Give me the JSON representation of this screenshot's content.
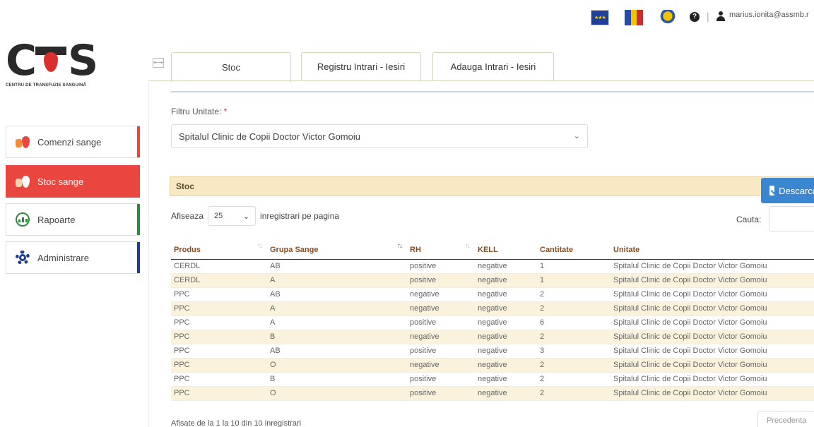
{
  "header": {
    "user_email": "marius.ionita@assmb.r",
    "help_glyph": "?",
    "separator": "|"
  },
  "logo": {
    "letter_c": "C",
    "letter_s": "S",
    "subtitle": "CENTRU DE TRANSFUZIE SANGUINĂ"
  },
  "sidebar": {
    "items": [
      {
        "label": "Comenzi sange",
        "icon": "blood-drop-icon",
        "edge_color": "#e8463f"
      },
      {
        "label": "Stoc sange",
        "icon": "blood-drop-icon",
        "edge_color": "#e8463f",
        "active": true
      },
      {
        "label": "Rapoarte",
        "icon": "chart-icon",
        "edge_color": "#2e8b3e"
      },
      {
        "label": "Administrare",
        "icon": "gear-icon",
        "edge_color": "#1e3f8a"
      }
    ]
  },
  "tabs": [
    {
      "label": "Stoc",
      "active": true
    },
    {
      "label": "Registru Intrari - Iesiri"
    },
    {
      "label": "Adauga Intrari - Iesiri"
    }
  ],
  "filter": {
    "label": "Filtru Unitate:",
    "required_mark": "*",
    "selected": "Spitalul Clinic de Copii Doctor Victor Gomoiu"
  },
  "stoc_panel": {
    "title": "Stoc",
    "download_label": "Descarca"
  },
  "length_menu": {
    "prefix": "Afiseaza",
    "value": "25",
    "suffix": "inregistrari pe pagina"
  },
  "search": {
    "label": "Cauta:",
    "value": ""
  },
  "table": {
    "columns": [
      "Produs",
      "Grupa Sange",
      "RH",
      "KELL",
      "Cantitate",
      "Unitate"
    ],
    "rows": [
      [
        "CERDL",
        "AB",
        "positive",
        "negative",
        "1",
        "Spitalul Clinic de Copii Doctor Victor Gomoiu"
      ],
      [
        "CERDL",
        "A",
        "positive",
        "negative",
        "1",
        "Spitalul Clinic de Copii Doctor Victor Gomoiu"
      ],
      [
        "PPC",
        "AB",
        "negative",
        "negative",
        "2",
        "Spitalul Clinic de Copii Doctor Victor Gomoiu"
      ],
      [
        "PPC",
        "A",
        "negative",
        "negative",
        "2",
        "Spitalul Clinic de Copii Doctor Victor Gomoiu"
      ],
      [
        "PPC",
        "A",
        "positive",
        "negative",
        "6",
        "Spitalul Clinic de Copii Doctor Victor Gomoiu"
      ],
      [
        "PPC",
        "B",
        "negative",
        "negative",
        "2",
        "Spitalul Clinic de Copii Doctor Victor Gomoiu"
      ],
      [
        "PPC",
        "AB",
        "positive",
        "negative",
        "3",
        "Spitalul Clinic de Copii Doctor Victor Gomoiu"
      ],
      [
        "PPC",
        "O",
        "negative",
        "negative",
        "2",
        "Spitalul Clinic de Copii Doctor Victor Gomoiu"
      ],
      [
        "PPC",
        "B",
        "positive",
        "negative",
        "2",
        "Spitalul Clinic de Copii Doctor Victor Gomoiu"
      ],
      [
        "PPC",
        "O",
        "positive",
        "negative",
        "2",
        "Spitalul Clinic de Copii Doctor Victor Gomoiu"
      ]
    ]
  },
  "footer": {
    "info": "Afisate de la 1 la 10 din 10 inregistrari",
    "prev_label": "Precedenta"
  }
}
